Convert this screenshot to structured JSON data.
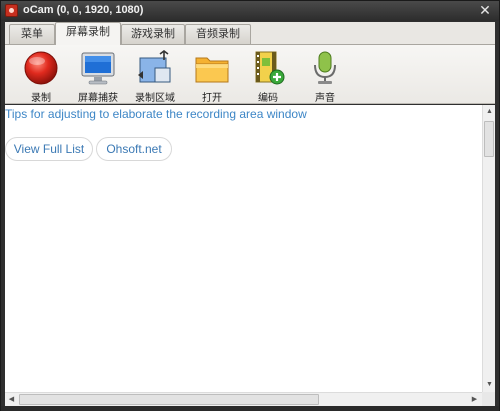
{
  "window": {
    "title": "oCam (0, 0, 1920, 1080)",
    "close_symbol": "✕"
  },
  "tabs": [
    {
      "label": "菜单"
    },
    {
      "label": "屏幕录制"
    },
    {
      "label": "游戏录制"
    },
    {
      "label": "音频录制"
    }
  ],
  "active_tab": "屏幕录制",
  "toolbar": {
    "items": [
      {
        "label": "录制",
        "icon": "record-icon"
      },
      {
        "label": "屏幕捕获",
        "icon": "monitor-icon"
      },
      {
        "label": "录制区域",
        "icon": "region-resize-icon"
      },
      {
        "label": "打开",
        "icon": "folder-icon"
      },
      {
        "label": "编码",
        "icon": "film-add-icon"
      },
      {
        "label": "声音",
        "icon": "microphone-icon"
      }
    ]
  },
  "content": {
    "tip_link": "Tips for adjusting to elaborate the recording area window",
    "buttons": [
      {
        "label": "View Full List"
      },
      {
        "label": "Ohsoft.net"
      }
    ]
  },
  "colors": {
    "link": "#3d86c6",
    "record_red": "#e02a1e",
    "titlebar": "#2c2c2c"
  }
}
